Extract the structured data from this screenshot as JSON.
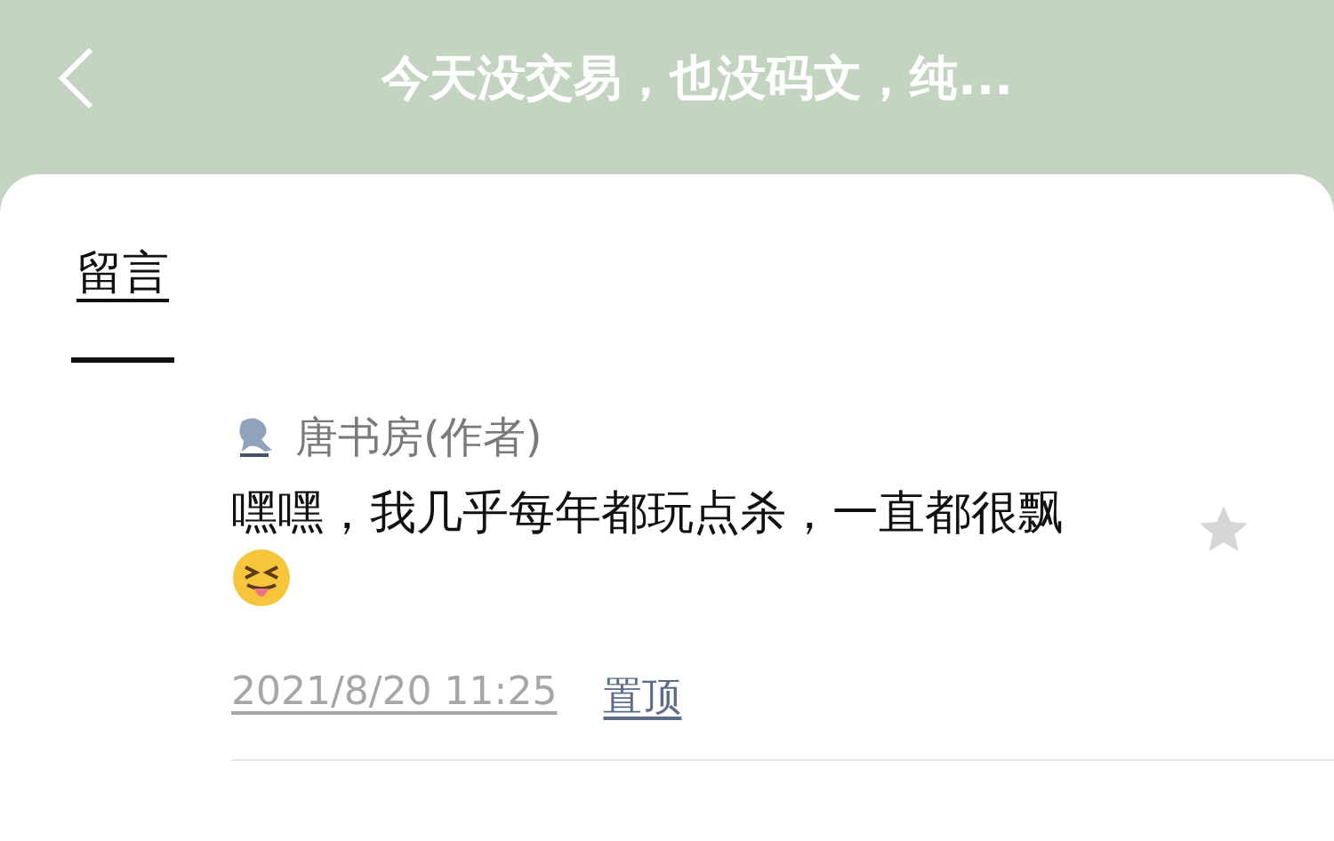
{
  "header": {
    "title": "今天没交易，也没码文，纯..."
  },
  "tabs": [
    {
      "label": "留言",
      "selected": true
    }
  ],
  "comments": [
    {
      "author": "唐书房(作者)",
      "text": "嘿嘿，我几乎每年都玩点杀，一直都很飘",
      "starred": false,
      "time": "2021/8/20 11:25",
      "actions": [
        "置顶"
      ]
    }
  ]
}
